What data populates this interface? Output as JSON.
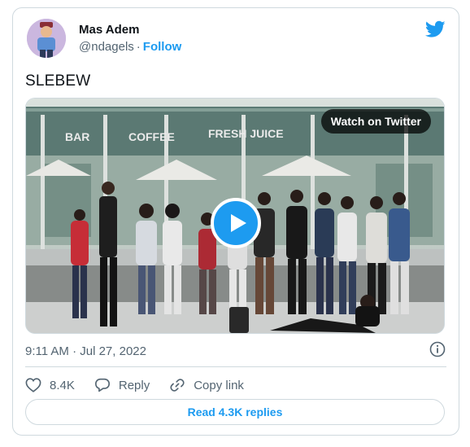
{
  "author": {
    "name": "Mas Adem",
    "handle": "@ndagels",
    "separator": "·",
    "follow_label": "Follow"
  },
  "tweet": {
    "text": "SLEBEW",
    "timestamp": "9:11 AM · Jul 27, 2022"
  },
  "media": {
    "watch_label": "Watch on Twitter",
    "signage": [
      "BAR",
      "COFFEE",
      "FRESH JUICE"
    ]
  },
  "actions": {
    "likes": "8.4K",
    "reply_label": "Reply",
    "copy_label": "Copy link"
  },
  "footer": {
    "read_replies_label": "Read 4.3K replies"
  },
  "colors": {
    "accent": "#1d9bf0",
    "muted": "#536471",
    "border": "#cfd9de"
  },
  "icons": [
    "twitter-bird-icon",
    "play-icon",
    "info-icon",
    "heart-icon",
    "reply-bubble-icon",
    "link-icon"
  ]
}
